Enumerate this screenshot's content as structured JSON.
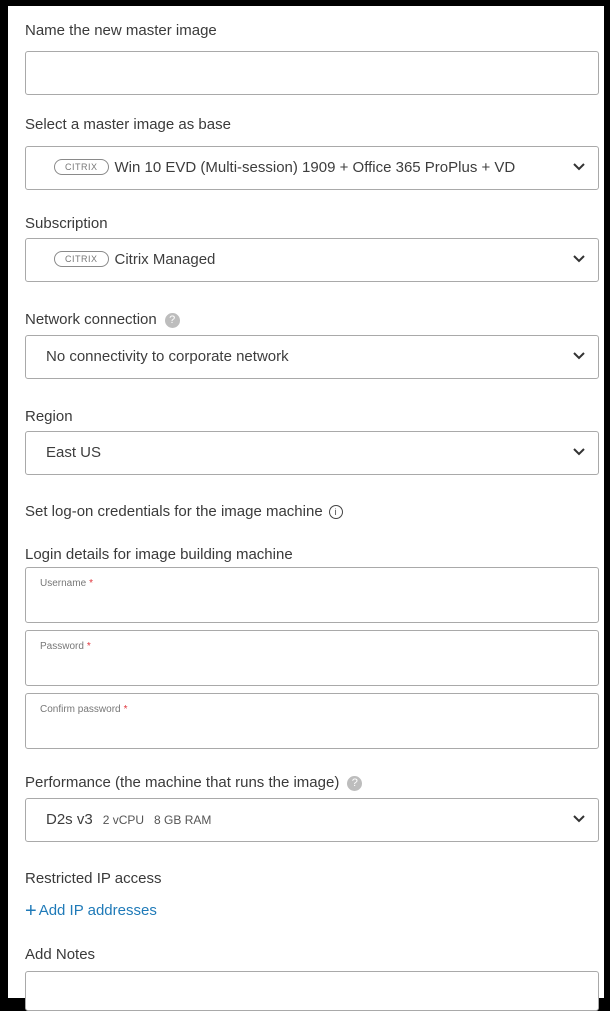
{
  "form": {
    "name_label": "Name the new master image",
    "name_value": "",
    "base_label": "Select a master image as base",
    "base_badge": "CITRIX",
    "base_value": "Win 10 EVD (Multi-session) 1909 + Office 365 ProPlus + VD",
    "subscription_label": "Subscription",
    "subscription_badge": "CITRIX",
    "subscription_value": "Citrix Managed",
    "network_label": "Network connection",
    "network_value": "No connectivity to corporate network",
    "region_label": "Region",
    "region_value": "East US",
    "credentials_heading": "Set log-on credentials for the image machine",
    "login_heading": "Login details for image building machine",
    "username_label": "Username",
    "password_label": "Password",
    "confirm_label": "Confirm password",
    "required_mark": "*",
    "performance_label": "Performance (the machine that runs the image)",
    "performance_size": "D2s v3",
    "performance_vcpu": "2 vCPU",
    "performance_ram": "8 GB RAM",
    "restricted_label": "Restricted IP access",
    "add_ip_plus": "+",
    "add_ip_label": "Add IP addresses",
    "notes_label": "Add Notes"
  },
  "icons": {
    "help": "?",
    "info": "i"
  },
  "colors": {
    "link": "#1f7ab8",
    "required": "#e0343c",
    "border": "#a9a9a9"
  }
}
